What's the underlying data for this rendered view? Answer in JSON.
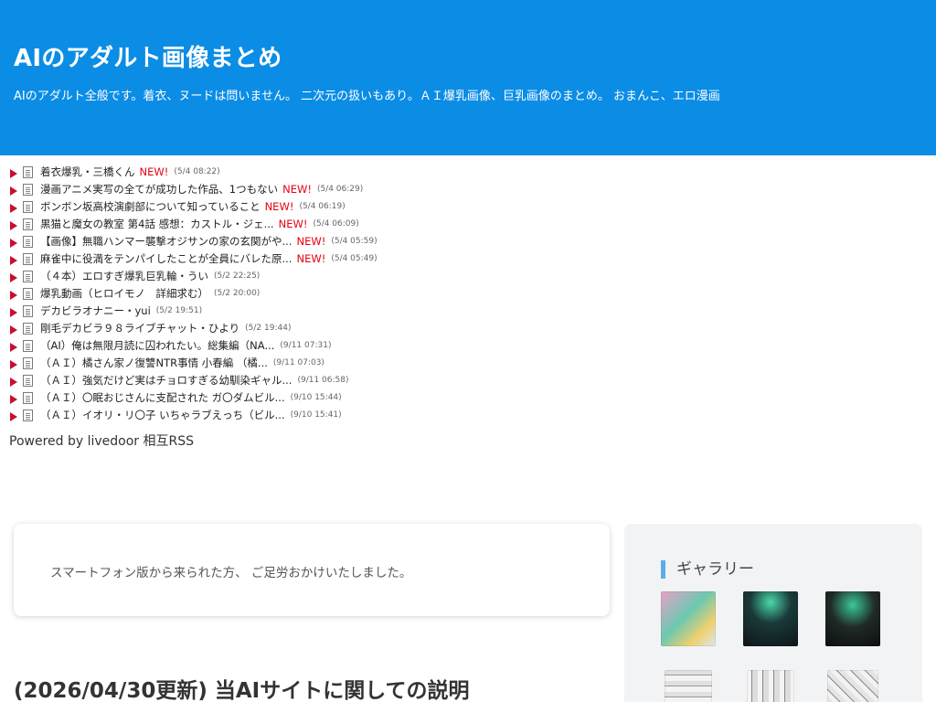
{
  "header": {
    "title": "AIのアダルト画像まとめ",
    "description": "AIのアダルト全般です。着衣、ヌードは問いません。 二次元の扱いもあり。ＡＩ爆乳画像、巨乳画像のまとめ。 おまんこ、エロ漫画"
  },
  "colors": {
    "header_bg": "#0b8de6",
    "new_badge": "#e60012",
    "arrow": "#c8102e",
    "gallery_accent": "#5aaee8"
  },
  "rss_items": [
    {
      "title": "着衣爆乳・三橋くん",
      "new": "NEW!",
      "date": "(5/4 08:22)"
    },
    {
      "title": "漫画アニメ実写の全てが成功した作品、1つもない",
      "new": "NEW!",
      "date": "(5/4 06:29)"
    },
    {
      "title": "ボンボン坂高校演劇部について知っていること",
      "new": "NEW!",
      "date": "(5/4 06:19)"
    },
    {
      "title": "黒猫と魔女の教室 第4話 感想：カストル・ジェ...",
      "new": "NEW!",
      "date": "(5/4 06:09)"
    },
    {
      "title": "【画像】無職ハンマー襲撃オジサンの家の玄関がや...",
      "new": "NEW!",
      "date": "(5/4 05:59)"
    },
    {
      "title": "麻雀中に役満をテンパイしたことが全員にバレた原...",
      "new": "NEW!",
      "date": "(5/4 05:49)"
    },
    {
      "title": "（４本）エロすぎ爆乳巨乳輪・うい",
      "new": "",
      "date": "(5/2 22:25)"
    },
    {
      "title": "爆乳動画（ヒロイモノ　詳細求む）",
      "new": "",
      "date": "(5/2 20:00)"
    },
    {
      "title": "デカビラオナニー・yui",
      "new": "",
      "date": "(5/2 19:51)"
    },
    {
      "title": "剛毛デカビラ９８ライブチャット・ひより",
      "new": "",
      "date": "(5/2 19:44)"
    },
    {
      "title": "（AI）俺は無限月読に囚われたい。総集編（NA...",
      "new": "",
      "date": "(9/11 07:31)"
    },
    {
      "title": "（ＡＩ）橘さん家ノ復讐NTR事情 小春編 （橘...",
      "new": "",
      "date": "(9/11 07:03)"
    },
    {
      "title": "（ＡＩ）強気だけど実はチョロすぎる幼馴染ギャル...",
      "new": "",
      "date": "(9/11 06:58)"
    },
    {
      "title": "（ＡＩ）〇眠おじさんに支配された ガ〇ダムビル...",
      "new": "",
      "date": "(9/10 15:44)"
    },
    {
      "title": "（ＡＩ）イオリ・リ〇子 いちゃラブえっち（ビル...",
      "new": "",
      "date": "(9/10 15:41)"
    }
  ],
  "powered": {
    "prefix": "Powered by",
    "link": "livedoor 相互RSS"
  },
  "notice": {
    "text": "スマートフォン版から来られた方、 ご足労おかけいたしました。"
  },
  "article": {
    "title": "(2026/04/30更新) 当AIサイトに関しての説明"
  },
  "sidebar": {
    "gallery_heading": "ギャラリー"
  }
}
